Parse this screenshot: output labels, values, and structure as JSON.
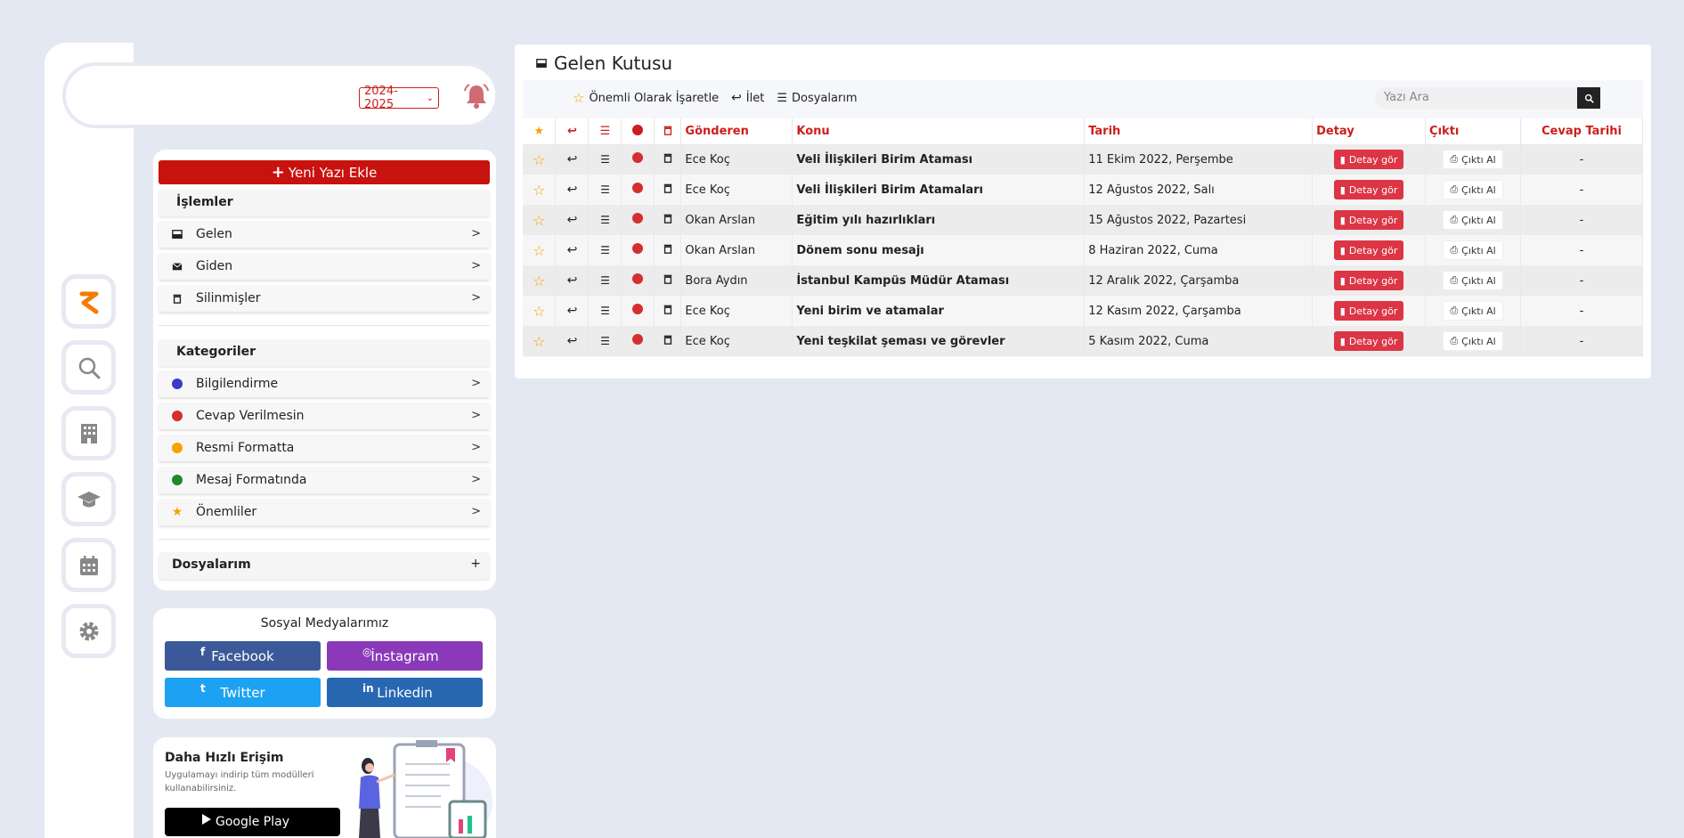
{
  "header": {
    "year_selected": "2024-2025"
  },
  "sidebar_rail": [
    {
      "icon": "brand-logo-icon"
    },
    {
      "icon": "search-icon"
    },
    {
      "icon": "building-icon"
    },
    {
      "icon": "graduation-cap-icon"
    },
    {
      "icon": "calendar-icon"
    },
    {
      "icon": "gear-icon"
    }
  ],
  "panel": {
    "add_button": "Yeni Yazı Ekle",
    "islemler_title": "İşlemler",
    "islemler": [
      {
        "label": "Gelen",
        "icon": "inbox-icon"
      },
      {
        "label": "Giden",
        "icon": "envelope-icon"
      },
      {
        "label": "Silinmişler",
        "icon": "trash-icon"
      }
    ],
    "kategoriler_title": "Kategoriler",
    "kategoriler": [
      {
        "label": "Bilgilendirme",
        "color": "#3b3bc8"
      },
      {
        "label": "Cevap Verilmesin",
        "color": "#d32f2f"
      },
      {
        "label": "Resmi Formatta",
        "color": "#f5a300"
      },
      {
        "label": "Mesaj Formatında",
        "color": "#1b8a2a"
      },
      {
        "label": "Önemliler",
        "color": "#f5a300",
        "icon": "star-icon"
      }
    ],
    "dosyalarim_title": "Dosyalarım",
    "dosyalarim_toggle": "+"
  },
  "social": {
    "title": "Sosyal Medyalarımız",
    "buttons": [
      {
        "label": "Facebook",
        "icon_text": "f",
        "color": "#3b5998"
      },
      {
        "label": "İnstagram",
        "icon_text": "◎",
        "color": "#8a3ab9"
      },
      {
        "label": "Twitter",
        "icon_text": "t",
        "color": "#1da1f2"
      },
      {
        "label": "Linkedin",
        "icon_text": "in",
        "color": "#2867b2"
      }
    ]
  },
  "promo": {
    "title": "Daha Hızlı Erişim",
    "desc": "Uygulamayı indirip tüm modülleri kullanabilirsiniz.",
    "store_button": "Google Play"
  },
  "mailbox": {
    "title": "Gelen Kutusu",
    "toolbar": [
      {
        "label": "Önemli Olarak İşaretle",
        "icon": "star-outline-icon"
      },
      {
        "label": "İlet",
        "icon": "reply-icon"
      },
      {
        "label": "Dosyalarım",
        "icon": "list-icon"
      }
    ],
    "search_placeholder": "Yazı Ara",
    "columns": {
      "sender": "Gönderen",
      "subject": "Konu",
      "date": "Tarih",
      "detail": "Detay",
      "output": "Çıktı",
      "reply_date": "Cevap Tarihi"
    },
    "detail_button": "Detay gör",
    "output_button": "Çıktı Al",
    "rows": [
      {
        "sender": "Ece Koç",
        "subject": "Veli İlişkileri Birim Ataması",
        "date": "11 Ekim 2022, Perşembe",
        "reply_date": "-"
      },
      {
        "sender": "Ece Koç",
        "subject": "Veli İlişkileri Birim Atamaları",
        "date": "12 Ağustos 2022, Salı",
        "reply_date": "-"
      },
      {
        "sender": "Okan Arslan",
        "subject": "Eğitim yılı hazırlıkları",
        "date": "15 Ağustos 2022, Pazartesi",
        "reply_date": "-"
      },
      {
        "sender": "Okan Arslan",
        "subject": "Dönem sonu mesajı",
        "date": "8 Haziran 2022, Cuma",
        "reply_date": "-"
      },
      {
        "sender": "Bora Aydın",
        "subject": "İstanbul Kampüs Müdür Ataması",
        "date": "12 Aralık 2022, Çarşamba",
        "reply_date": "-"
      },
      {
        "sender": "Ece Koç",
        "subject": "Yeni birim ve atamalar",
        "date": "12 Kasım 2022, Çarşamba",
        "reply_date": "-"
      },
      {
        "sender": "Ece Koç",
        "subject": "Yeni teşkilat şeması ve görevler",
        "date": "5 Kasım 2022, Cuma",
        "reply_date": "-"
      }
    ]
  },
  "colors": {
    "accent_red": "#cc1e1e",
    "button_red": "#dc3545",
    "add_button": "#c8120e",
    "star": "#f5a300",
    "brand_orange": "#f57c00"
  }
}
